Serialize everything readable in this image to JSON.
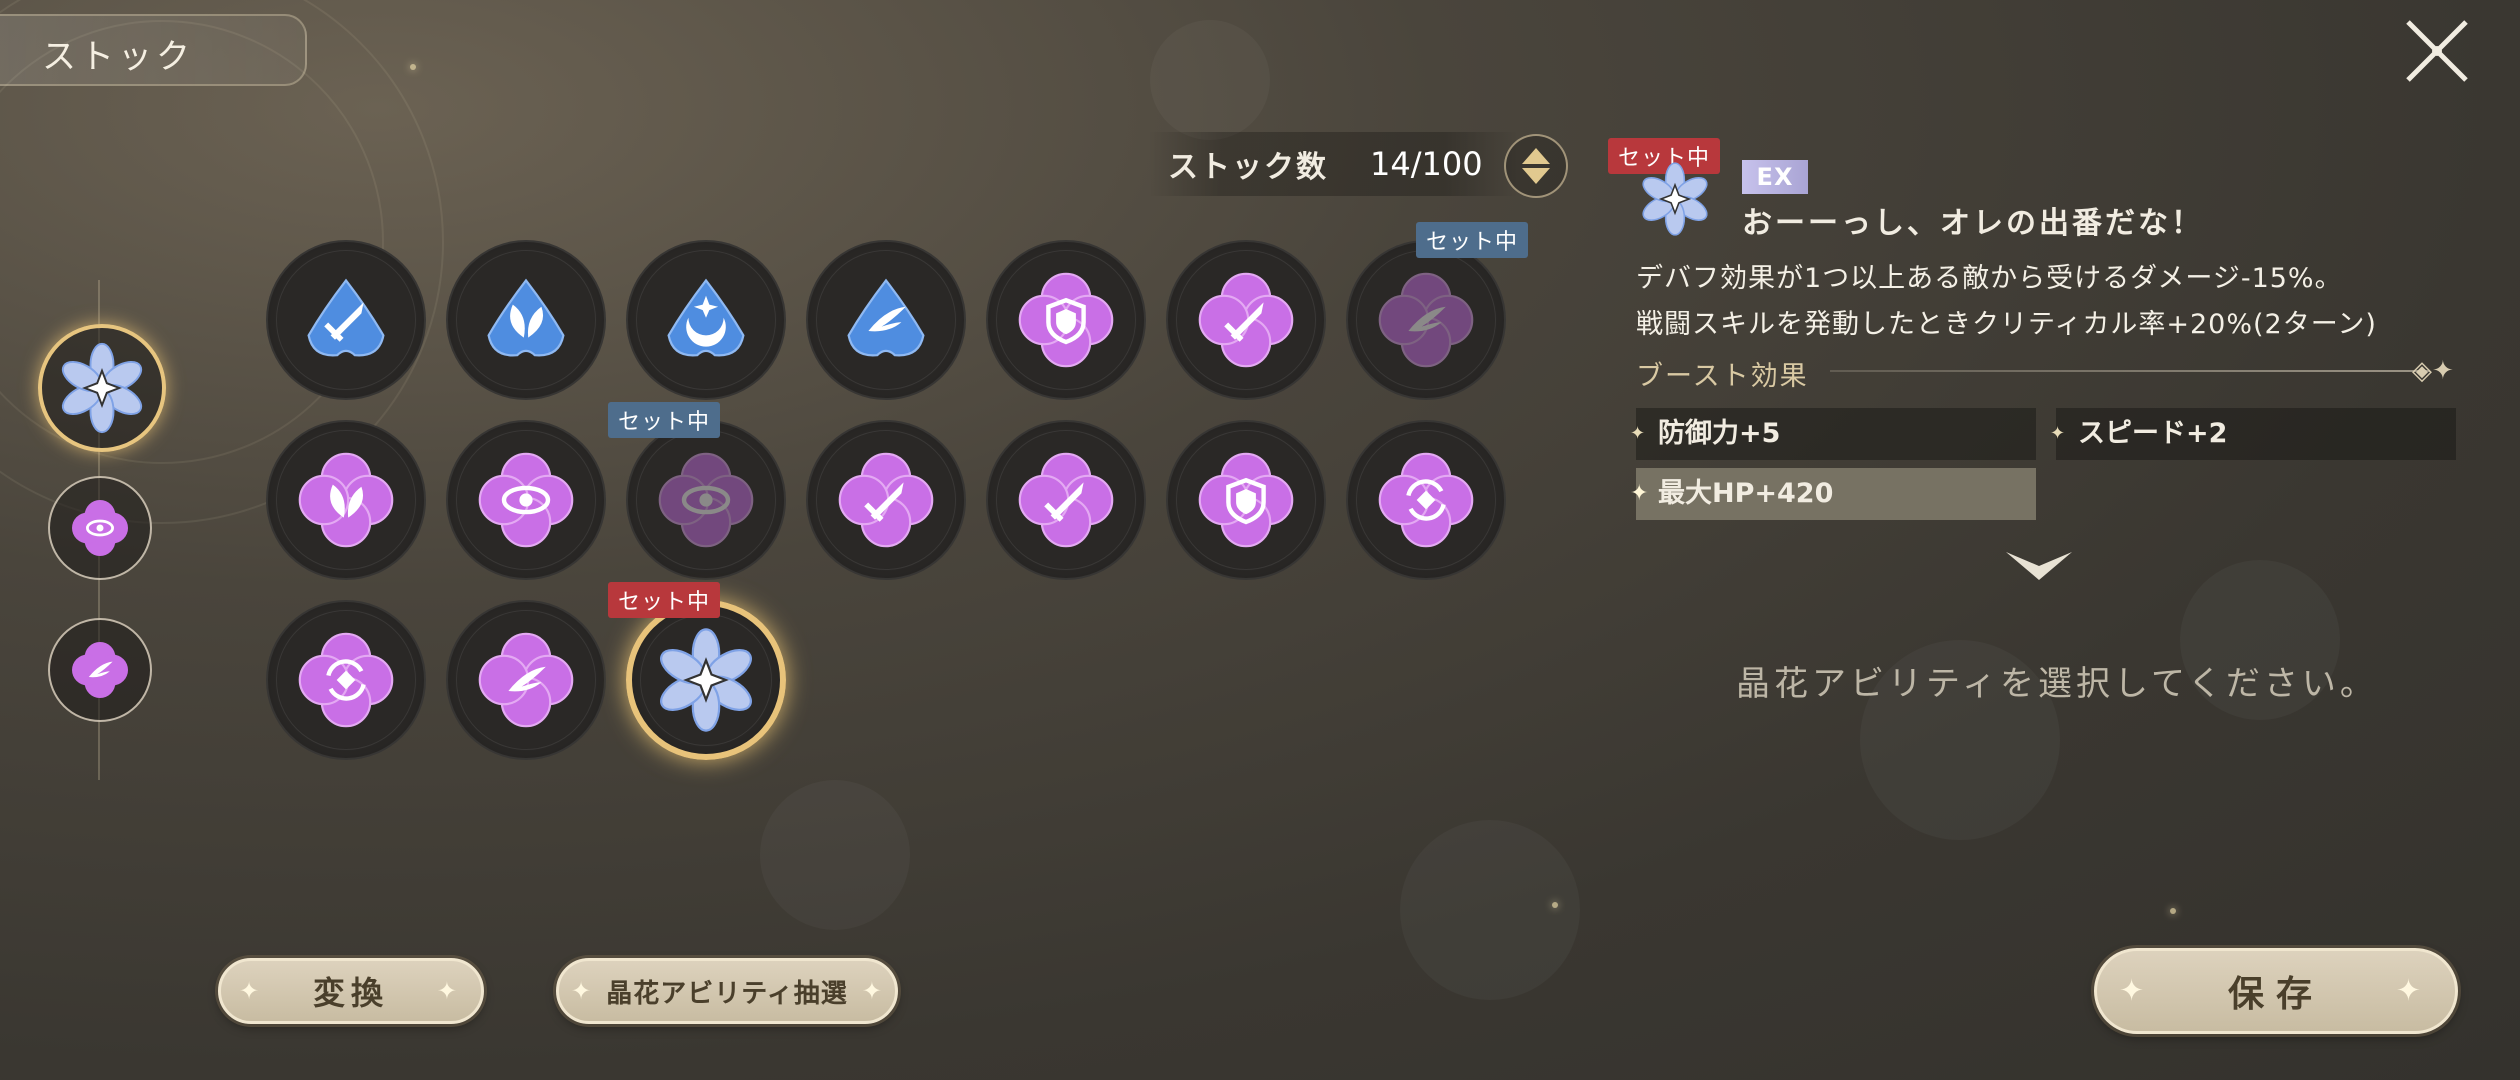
{
  "header": {
    "title": "ストック"
  },
  "stock": {
    "label": "ストック数",
    "value": "14/100"
  },
  "badges": {
    "set": "セット中"
  },
  "detail": {
    "rank": "EX",
    "name": "おーーっし、オレの出番だな！",
    "description_1": "デバフ効果が1つ以上ある敵から受けるダメージ-15%。",
    "description_2": "戦闘スキルを発動したときクリティカル率+20%(2ターン)",
    "boost_title": "ブースト効果",
    "boosts": [
      "防御力+5",
      "スピード+2",
      "最大HP+420"
    ]
  },
  "prompt": "晶花アビリティを選択してください。",
  "buttons": {
    "convert": "変換",
    "draw": "晶花アビリティ抽選",
    "save": "保存"
  },
  "colors": {
    "blue_crystal": "#4f8de0",
    "purple_crystal": "#c96fe6",
    "gold": "#e8c37a",
    "set_red": "#b8383c",
    "set_blue": "#4e6d8c"
  },
  "grid": [
    [
      {
        "color": "blue",
        "icon": "dagger-icon"
      },
      {
        "color": "blue",
        "icon": "leaf-icon"
      },
      {
        "color": "blue",
        "icon": "moon-icon"
      },
      {
        "color": "blue",
        "icon": "wing-icon"
      },
      {
        "color": "purple",
        "icon": "shield-icon"
      },
      {
        "color": "purple",
        "icon": "dagger-icon"
      },
      {
        "color": "purple",
        "icon": "wing-icon",
        "set": "blue",
        "dim": true
      }
    ],
    [
      {
        "color": "purple",
        "icon": "leaf-icon"
      },
      {
        "color": "purple",
        "icon": "eye-icon"
      },
      {
        "color": "purple",
        "icon": "eye-icon",
        "set": "blue",
        "dim": true
      },
      {
        "color": "purple",
        "icon": "dagger-icon"
      },
      {
        "color": "purple",
        "icon": "dagger-icon"
      },
      {
        "color": "purple",
        "icon": "shield-icon"
      },
      {
        "color": "purple",
        "icon": "cycle-icon"
      }
    ],
    [
      {
        "color": "purple",
        "icon": "cycle-icon"
      },
      {
        "color": "purple",
        "icon": "wing-icon"
      },
      {
        "color": "rainbow",
        "icon": "star-flower-icon",
        "set": "red",
        "selected": true
      }
    ]
  ]
}
